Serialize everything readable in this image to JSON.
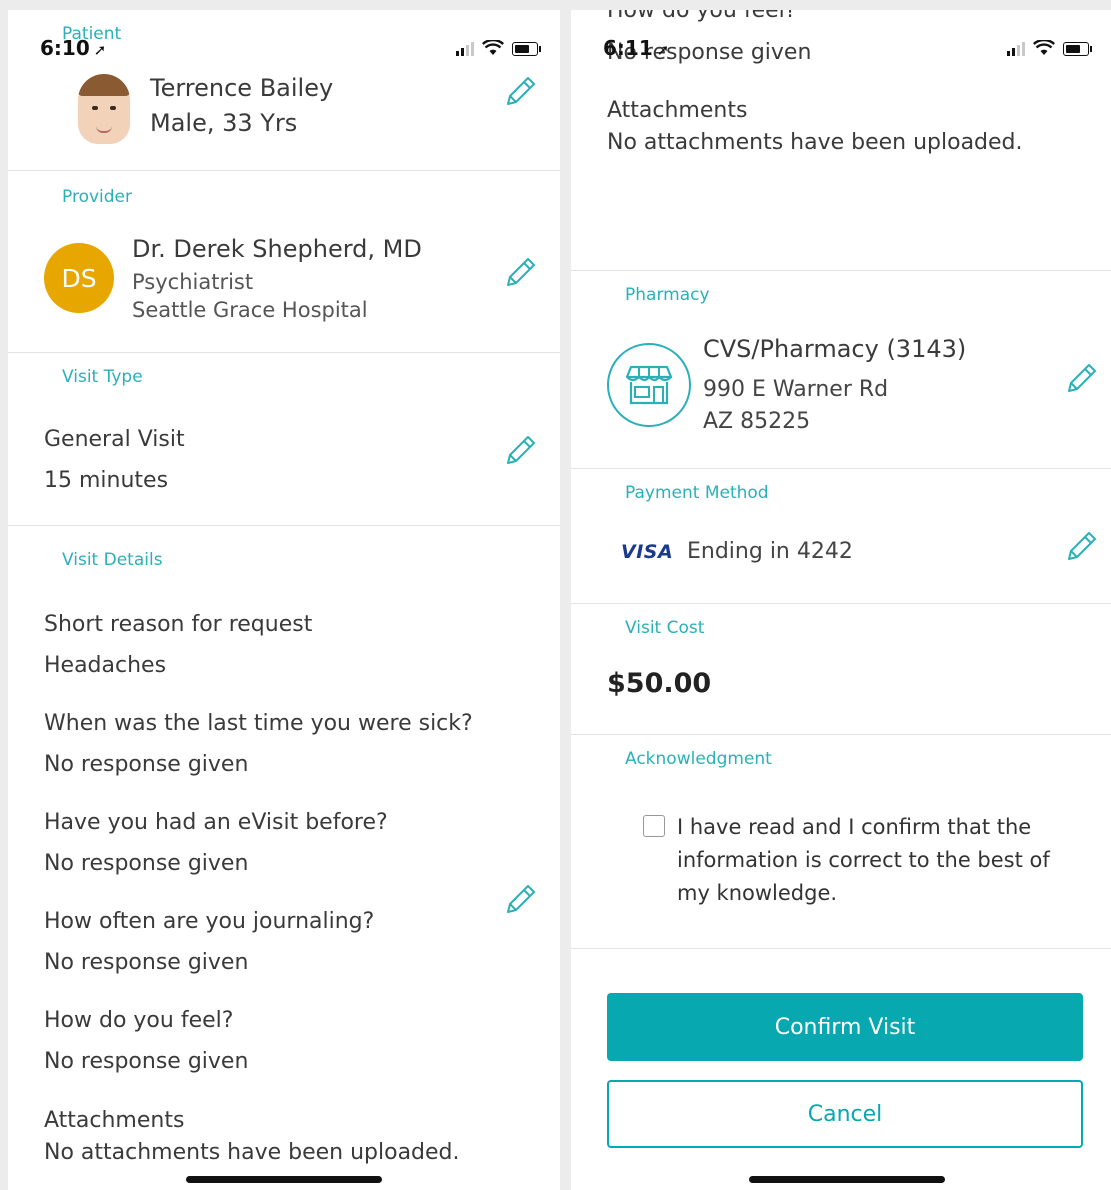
{
  "left": {
    "status": {
      "time": "6:10"
    },
    "patient": {
      "label": "Patient",
      "name": "Terrence Bailey",
      "details": "Male, 33 Yrs"
    },
    "provider": {
      "label": "Provider",
      "initials": "DS",
      "name": "Dr. Derek Shepherd, MD",
      "specialty": "Psychiatrist",
      "hospital": "Seattle Grace Hospital"
    },
    "visit_type": {
      "label": "Visit Type",
      "type": "General Visit",
      "duration": "15 minutes"
    },
    "visit_details": {
      "label": "Visit Details",
      "items": [
        {
          "question": "Short reason for request",
          "answer": "Headaches"
        },
        {
          "question": "When was the last time you were sick?",
          "answer": "No response given"
        },
        {
          "question": "Have you had an eVisit before?",
          "answer": "No response given"
        },
        {
          "question": "How often are you journaling?",
          "answer": "No response given"
        },
        {
          "question": "How do you feel?",
          "answer": "No response given"
        }
      ],
      "attachments_label": "Attachments",
      "attachments_value": "No attachments have been uploaded."
    }
  },
  "right": {
    "status": {
      "time": "6:11"
    },
    "scrolled": {
      "question": "How do you feel?",
      "answer": "No response given",
      "attachments_label": "Attachments",
      "attachments_value": "No attachments have been uploaded."
    },
    "pharmacy": {
      "label": "Pharmacy",
      "name": "CVS/Pharmacy (3143)",
      "address1": "990 E Warner Rd",
      "address2": "AZ 85225"
    },
    "payment": {
      "label": "Payment Method",
      "brand": "VISA",
      "ending": "Ending in 4242"
    },
    "cost": {
      "label": "Visit Cost",
      "value": "$50.00"
    },
    "acknowledgment": {
      "label": "Acknowledgment",
      "text": "I have read and I confirm that the information is correct to the best of my knowledge."
    },
    "buttons": {
      "confirm": "Confirm Visit",
      "cancel": "Cancel"
    }
  },
  "colors": {
    "accent": "#08a8b0",
    "label": "#2bb0b8",
    "provider_badge": "#e7a600",
    "visa": "#1a3a8c"
  }
}
